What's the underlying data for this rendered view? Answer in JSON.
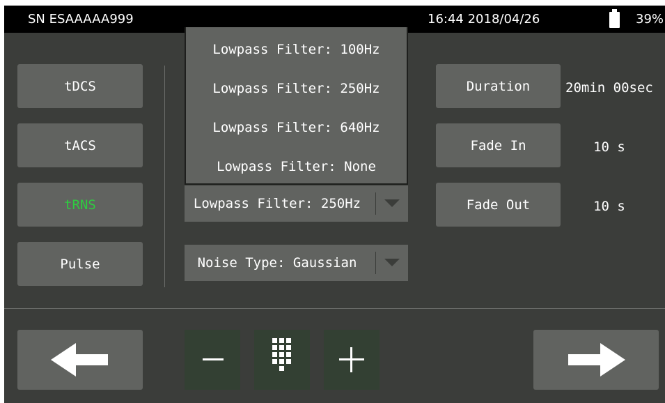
{
  "status": {
    "serial": "SN ESAAAAA999",
    "datetime": "16:44 2018/04/26",
    "battery_percent": "39%",
    "battery_icon": "battery-icon"
  },
  "modes": [
    {
      "label": "tDCS"
    },
    {
      "label": "tACS"
    },
    {
      "label": "tRNS",
      "selected": true,
      "color": "#2ecc40"
    },
    {
      "label": "Pulse"
    }
  ],
  "filter_options": [
    "Lowpass Filter: 100Hz",
    "Lowpass Filter: 250Hz",
    "Lowpass Filter: 640Hz",
    "Lowpass Filter: None"
  ],
  "lowpass_select": {
    "label": "Lowpass Filter: 250Hz",
    "icon": "dropdown-arrow-icon"
  },
  "noise_select": {
    "label": "Noise Type: Gaussian",
    "icon": "dropdown-arrow-icon"
  },
  "params": {
    "duration": {
      "label": "Duration",
      "value": "20min 00sec"
    },
    "fade_in": {
      "label": "Fade In",
      "value": "10 s"
    },
    "fade_out": {
      "label": "Fade Out",
      "value": "10 s"
    }
  },
  "footer": {
    "back_icon": "arrow-left-icon",
    "minus_icon": "minus-icon",
    "keypad_icon": "keypad-icon",
    "plus_icon": "plus-icon",
    "next_icon": "arrow-right-icon"
  },
  "colors": {
    "background": "#3b3d3a",
    "button": "#616360",
    "small_button": "#334033",
    "selected_text": "#2ecc40"
  }
}
